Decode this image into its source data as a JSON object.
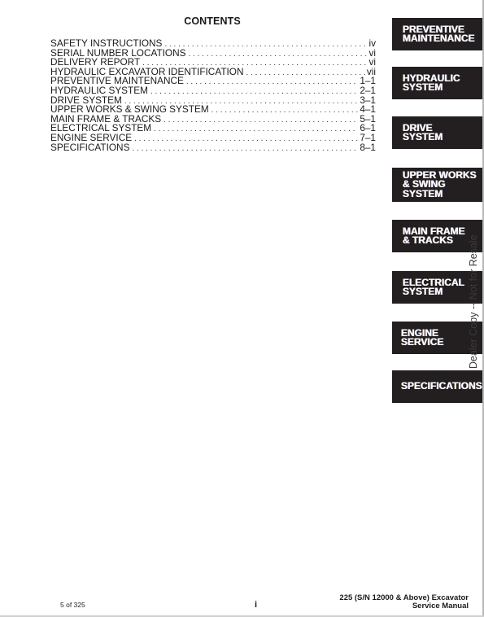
{
  "page": {
    "title": "CONTENTS",
    "toc": [
      {
        "label": "SAFETY INSTRUCTIONS",
        "page": "iv"
      },
      {
        "label": "SERIAL NUMBER LOCATIONS",
        "page": "vi"
      },
      {
        "label": "DELIVERY REPORT",
        "page": "vi"
      },
      {
        "label": "HYDRAULIC EXCAVATOR IDENTIFICATION",
        "page": "vii"
      },
      {
        "label": "PREVENTIVE MAINTENANCE",
        "page": "1–1"
      },
      {
        "label": "HYDRAULIC SYSTEM",
        "page": "2–1"
      },
      {
        "label": "DRIVE SYSTEM",
        "page": "3–1"
      },
      {
        "label": "UPPER WORKS & SWING SYSTEM",
        "page": "4–1"
      },
      {
        "label": "MAIN FRAME & TRACKS",
        "page": "5–1"
      },
      {
        "label": "ELECTRICAL SYSTEM",
        "page": "6–1"
      },
      {
        "label": "ENGINE SERVICE",
        "page": "7–1"
      },
      {
        "label": "SPECIFICATIONS",
        "page": "8–1"
      }
    ],
    "tabs": [
      {
        "lines": [
          "PREVENTIVE",
          "MAINTENANCE"
        ]
      },
      {
        "lines": [
          "HYDRAULIC",
          "SYSTEM"
        ]
      },
      {
        "lines": [
          "DRIVE",
          "SYSTEM"
        ]
      },
      {
        "lines": [
          "UPPER WORKS",
          "& SWING",
          "SYSTEM"
        ]
      },
      {
        "lines": [
          "MAIN FRAME",
          "& TRACKS"
        ]
      },
      {
        "lines": [
          "ELECTRICAL",
          "SYSTEM"
        ]
      },
      {
        "lines": [
          "ENGINE",
          "SERVICE"
        ]
      },
      {
        "lines": [
          "SPECIFICATIONS"
        ]
      }
    ],
    "watermark": "Dealer Copy -- Not for Resale",
    "footer": {
      "page_count": "5 of 325",
      "roman_page": "i",
      "title_line1": "225 (S/N 12000 & Above) Excavator",
      "title_line2": "Service Manual"
    },
    "colors": {
      "tab_background": "#231f20",
      "tab_text": "#ffffff",
      "text": "#1a1a1a"
    }
  }
}
